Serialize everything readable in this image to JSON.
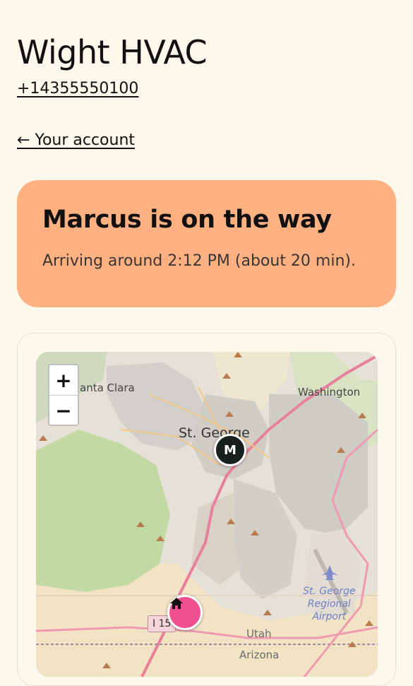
{
  "header": {
    "company_name": "Wight HVAC",
    "phone": "+14355550100",
    "back_link": "← Your account"
  },
  "status": {
    "title": "Marcus is on the way",
    "subtitle": "Arriving around 2:12 PM (about 20 min).",
    "card_color": "#ffb182"
  },
  "map": {
    "zoom_in": "+",
    "zoom_out": "−",
    "labels": {
      "santa_clara": "anta Clara",
      "washington": "Washington",
      "st_george": "St. George",
      "airport_line1": "St. George",
      "airport_line2": "Regional",
      "airport_line3": "Airport",
      "utah": "Utah",
      "arizona": "Arizona",
      "highway": "I 15"
    },
    "technician_marker": "M",
    "technician_marker_color": "#17201e",
    "home_marker_icon": "home-icon",
    "home_marker_color": "#ef4e8f"
  }
}
